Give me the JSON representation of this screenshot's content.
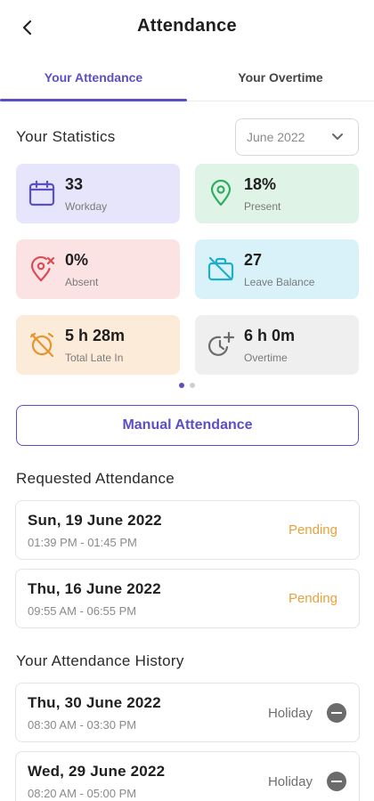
{
  "header": {
    "title": "Attendance",
    "back_icon": "chevron-left-icon"
  },
  "tabs": [
    {
      "label": "Your Attendance",
      "active": true
    },
    {
      "label": "Your Overtime",
      "active": false
    }
  ],
  "statistics": {
    "title": "Your Statistics",
    "month": "June 2022",
    "cards": [
      {
        "value": "33",
        "label": "Workday",
        "icon": "calendar-icon",
        "bg": "#e7e5fb",
        "color": "#5b4fc4"
      },
      {
        "value": "18%",
        "label": "Present",
        "icon": "location-pin-icon",
        "bg": "#dff3e6",
        "color": "#2eae5e"
      },
      {
        "value": "0%",
        "label": "Absent",
        "icon": "location-off-icon",
        "bg": "#fbe3e4",
        "color": "#e04a54"
      },
      {
        "value": "27",
        "label": "Leave Balance",
        "icon": "briefcase-off-icon",
        "bg": "#d9f2f9",
        "color": "#1eaec9"
      },
      {
        "value": "5 h 28m",
        "label": "Total Late In",
        "icon": "alarm-off-icon",
        "bg": "#fdebd9",
        "color": "#e8932e"
      },
      {
        "value": "6 h 0m",
        "label": "Overtime",
        "icon": "clock-plus-icon",
        "bg": "#efefef",
        "color": "#6b6b6b"
      }
    ],
    "pager": {
      "pages": 2,
      "current": 1
    }
  },
  "manual_button": "Manual Attendance",
  "requested": {
    "title": "Requested Attendance",
    "items": [
      {
        "date": "Sun, 19 June 2022",
        "time": "01:39 PM - 01:45 PM",
        "status": "Pending"
      },
      {
        "date": "Thu, 16 June 2022",
        "time": "09:55 AM - 06:55 PM",
        "status": "Pending"
      }
    ]
  },
  "history": {
    "title": "Your Attendance History",
    "items": [
      {
        "date": "Thu, 30 June 2022",
        "time": "08:30 AM - 03:30 PM",
        "status": "Holiday"
      },
      {
        "date": "Wed, 29 June 2022",
        "time": "08:20 AM - 05:00 PM",
        "status": "Holiday"
      }
    ]
  },
  "colors": {
    "accent": "#5b4fc4",
    "pending": "#e8a23b"
  }
}
